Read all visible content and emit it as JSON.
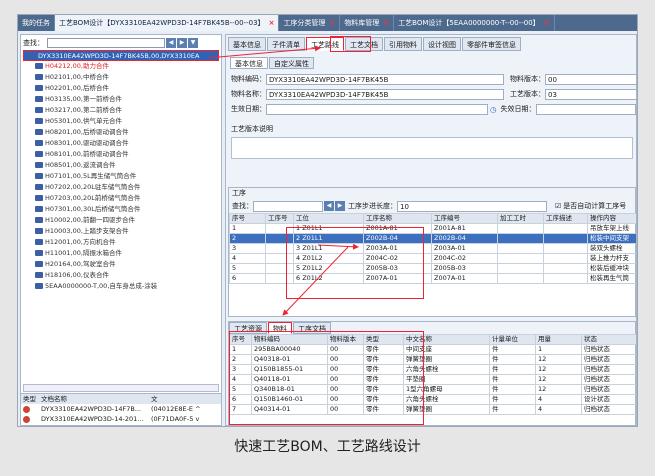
{
  "tabs": [
    {
      "label": "我的任务",
      "active": false
    },
    {
      "label": "工艺BOM设计【DYX3310EA42WPD3D-14F7BK45B--00--03】",
      "active": true
    },
    {
      "label": "工序分类管理",
      "active": false
    },
    {
      "label": "物料库管理",
      "active": false
    },
    {
      "label": "工艺BOM设计【5EAA0000000-T--00--00】",
      "active": false
    }
  ],
  "left": {
    "search_label": "查找：",
    "tree": [
      {
        "label": "DYX3310EA42WPD3D-14F7BK45B,00,DYX3310EA",
        "sel": true,
        "red": false
      },
      {
        "label": "H04212,00,助力合件",
        "sel": false,
        "red": true
      },
      {
        "label": "H02101,00,中桥合件",
        "sel": false,
        "red": false
      },
      {
        "label": "H02201,00,后桥合件",
        "sel": false,
        "red": false
      },
      {
        "label": "H03135,00,第一前桥合件",
        "sel": false,
        "red": false
      },
      {
        "label": "H03217,00,第二前桥合件",
        "sel": false,
        "red": false
      },
      {
        "label": "H05301,00,供气单元合件",
        "sel": false,
        "red": false
      },
      {
        "label": "H08201,00,后桥驱动调合件",
        "sel": false,
        "red": false
      },
      {
        "label": "H08301,00,驱动驱动调合件",
        "sel": false,
        "red": false
      },
      {
        "label": "H08101,00,前桥驱动调合件",
        "sel": false,
        "red": false
      },
      {
        "label": "H08501,00,返流调合件",
        "sel": false,
        "red": false
      },
      {
        "label": "H07101,00,5L再生储气筒合件",
        "sel": false,
        "red": false
      },
      {
        "label": "H07202,00,20L驻车储气筒合件",
        "sel": false,
        "red": false
      },
      {
        "label": "H07203,00,20L前桥储气筒合件",
        "sel": false,
        "red": false
      },
      {
        "label": "H07301,00,30L后桥储气筒合件",
        "sel": false,
        "red": false
      },
      {
        "label": "H10002,00,前翻一四驱步合件",
        "sel": false,
        "red": false
      },
      {
        "label": "H10003,00,上踏步支架合件",
        "sel": false,
        "red": false
      },
      {
        "label": "H12001,00,方向机合件",
        "sel": false,
        "red": false
      },
      {
        "label": "H11001,00,隔振水箱合件",
        "sel": false,
        "red": false
      },
      {
        "label": "H20164,00,驾驶室合件",
        "sel": false,
        "red": false
      },
      {
        "label": "H18106,00,仪表合件",
        "sel": false,
        "red": false
      },
      {
        "label": "5EAA0000000-T,00,自车身总成-涂装",
        "sel": false,
        "red": false
      }
    ],
    "doclist_header": [
      "类型",
      "文档名称",
      "文"
    ],
    "doclist": [
      {
        "name": "DYX3310EA42WPD3D-14F7B...",
        "code": "(04012E8E-E ^"
      },
      {
        "name": "DYX3310EA42WPD3D-14-201...",
        "code": "(0F71DA0F-5 v"
      }
    ]
  },
  "right": {
    "tabs": [
      "基本信息",
      "子件清单",
      "工艺路线",
      "工艺文档",
      "引用物料",
      "设计视图",
      "零部件审签信息"
    ],
    "active_tab": "工艺路线",
    "subtabs": [
      "基本信息",
      "自定义属性"
    ],
    "form": {
      "code_label": "物料编码：",
      "code": "DYX3310EA42WPD3D-14F7BK45B",
      "ver_label": "物料版本：",
      "ver": "00",
      "name_label": "物料名称：",
      "name": "DYX3310EA42WPD3D-14F7BK45B",
      "pver_label": "工艺版本：",
      "pver": "03",
      "eff_label": "生效日期：",
      "exp_label": "失效日期：",
      "desc_label": "工艺版本说明"
    },
    "proc": {
      "title": "工序",
      "search_label": "查找：",
      "step_label": "工序步进长度：",
      "step": "10",
      "auto_label": "是否自动计算工序号",
      "headers": [
        "序号",
        "工序号",
        "工位",
        "工序名称",
        "工序编号",
        "加工工时",
        "工序描述",
        "操作内容"
      ],
      "rows": [
        [
          "1",
          "",
          "1 Z01L1",
          "Z001A-81",
          "Z001A-81",
          "",
          "",
          "吊放车架上线"
        ],
        [
          "2",
          "",
          "2 Z01L1",
          "Z002B-04",
          "Z002B-04",
          "",
          "",
          "松装中间支架"
        ],
        [
          "3",
          "",
          "3 Z01L1",
          "Z003A-01",
          "Z003A-01",
          "",
          "",
          "装双头螺栓"
        ],
        [
          "4",
          "",
          "4 Z01L2",
          "Z004C-02",
          "Z004C-02",
          "",
          "",
          "装上推力杆支"
        ],
        [
          "5",
          "",
          "5 Z01L2",
          "Z005B-03",
          "Z005B-03",
          "",
          "",
          "松装后缓冲块"
        ],
        [
          "6",
          "",
          "6 Z01L2",
          "Z007A-01",
          "Z007A-01",
          "",
          "",
          "松装再生气筒"
        ]
      ],
      "selected": 1
    },
    "mat": {
      "tabs": [
        "工艺资源",
        "物料",
        "工序文档"
      ],
      "active": "物料",
      "headers": [
        "序号",
        "物料编码",
        "物料版本",
        "类型",
        "中文名称",
        "计量单位",
        "用量",
        "状态"
      ],
      "rows": [
        [
          "1",
          "295BBA00040",
          "00",
          "零件",
          "中间支座",
          "件",
          "1",
          "归档状态"
        ],
        [
          "2",
          "Q40318-01",
          "00",
          "零件",
          "弹簧垫圈",
          "件",
          "12",
          "归档状态"
        ],
        [
          "3",
          "Q150B1855-01",
          "00",
          "零件",
          "六角头螺栓",
          "件",
          "12",
          "归档状态"
        ],
        [
          "4",
          "Q40118-01",
          "00",
          "零件",
          "平垫圈",
          "件",
          "12",
          "归档状态"
        ],
        [
          "5",
          "Q340B18-01",
          "00",
          "零件",
          "1型六角螺母",
          "件",
          "12",
          "归档状态"
        ],
        [
          "6",
          "Q150B1460-01",
          "00",
          "零件",
          "六角头螺栓",
          "件",
          "4",
          "设计状态"
        ],
        [
          "7",
          "Q40314-01",
          "00",
          "零件",
          "弹簧垫圈",
          "件",
          "4",
          "归档状态"
        ]
      ]
    }
  },
  "caption": "快速工艺BOM、工艺路线设计"
}
